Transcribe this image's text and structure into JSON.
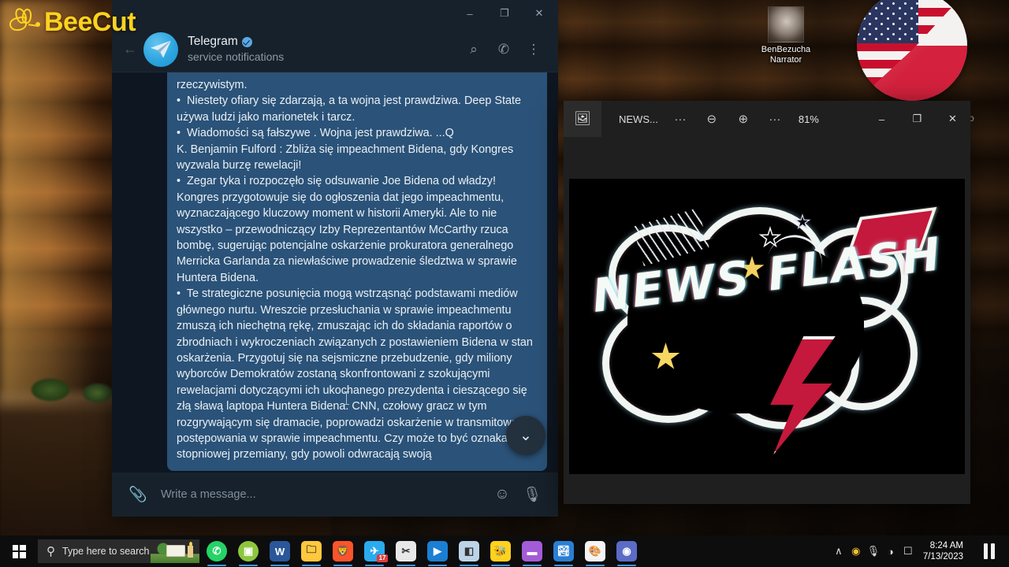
{
  "watermark": {
    "brand": "BeeCut",
    "icon": "bee-icon"
  },
  "desktop": {
    "shortcut": {
      "label_line1": "BenBezucha",
      "label_line2": "Narrator",
      "icon": "desktop-shortcut-icon"
    },
    "flag_graphic": {
      "name": "usa-poland-flag-circle"
    },
    "stray_glyph": "o"
  },
  "telegram": {
    "window_controls": {
      "minimize": "–",
      "maximize": "❐",
      "close": "✕"
    },
    "back_icon": "←",
    "chat": {
      "name": "Telegram",
      "verified": true,
      "subtitle": "service notifications",
      "avatar_icon": "telegram-plane-icon"
    },
    "header_actions": [
      {
        "name": "search-icon",
        "glyph": "⌕"
      },
      {
        "name": "call-icon",
        "glyph": "✆"
      },
      {
        "name": "more-menu-icon",
        "glyph": "⋮"
      }
    ],
    "message": "rzeczywistym.\n•  Niestety ofiary się zdarzają, a ta wojna jest prawdziwa. Deep State używa ludzi jako marionetek i tarcz.\n•  Wiadomości są fałszywe . Wojna jest prawdziwa. ...Q\nK. Benjamin Fulford : Zbliża się impeachment Bidena, gdy Kongres wyzwala burzę rewelacji!\n•  Zegar tyka i rozpoczęło się odsuwanie Joe Bidena od władzy! Kongres przygotowuje się do ogłoszenia dat jego impeachmentu, wyznaczającego kluczowy moment w historii Ameryki. Ale to nie wszystko – przewodniczący Izby Reprezentantów McCarthy rzuca bombę, sugerując potencjalne oskarżenie prokuratora generalnego Merricka Garlanda za niewłaściwe prowadzenie śledztwa w sprawie Huntera Bidena.\n•  Te strategiczne posunięcia mogą wstrząsnąć podstawami mediów głównego nurtu. Wreszcie przesłuchania w sprawie impeachmentu zmuszą ich niechętną rękę, zmuszając ich do składania raportów o zbrodniach i wykroczeniach związanych z postawieniem Bidena w stan oskarżenia. Przygotuj się na sejsmiczne przebudzenie, gdy miliony wyborców Demokratów zostaną skonfrontowani z szokującymi rewelacjami dotyczącymi ich ukochanego prezydenta i cieszącego się złą sławą laptopa Huntera Bidena. CNN, czołowy gracz w tym rozgrywającym się dramacie, poprowadzi oskarżenie w transmitowaniu postępowania w sprawie impeachmentu. Czy może to być oznaka ich stopniowej przemiany, gdy powoli odwracają swoją",
    "scroll_down_icon": "⌄",
    "composer": {
      "attach_icon": "📎",
      "placeholder": "Write a message...",
      "value": "",
      "emoji_icon": "☺",
      "mic_icon": "🎙"
    }
  },
  "photos": {
    "app_icon": "photos-app-icon",
    "filename": "NEWS...",
    "overflow_left": "···",
    "zoom_out_icon": "⊖",
    "zoom_in_icon": "⊕",
    "overflow_right": "···",
    "zoom_level": "81%",
    "window_controls": {
      "minimize": "–",
      "maximize": "❐",
      "close": "✕"
    },
    "image": {
      "title": "NEWS FLASH",
      "alt": "news-flash-logo"
    }
  },
  "taskbar": {
    "start": {
      "name": "start-button"
    },
    "search": {
      "placeholder": "Type here to search",
      "icon": "search-icon"
    },
    "apps": [
      {
        "name": "taskbar-whatsapp",
        "label": "✆",
        "color": "#25d366",
        "round": true,
        "open": true
      },
      {
        "name": "taskbar-greenapp",
        "label": "▣",
        "color": "#8cc63f",
        "round": true,
        "open": true
      },
      {
        "name": "taskbar-word",
        "label": "W",
        "color": "#2b579a",
        "open": true
      },
      {
        "name": "taskbar-file-explorer",
        "label": "🗀",
        "color": "#ffc83d",
        "open": true
      },
      {
        "name": "taskbar-brave",
        "label": "🦁",
        "color": "#fb542b",
        "open": true
      },
      {
        "name": "taskbar-telegram",
        "label": "✈",
        "color": "#2aabee",
        "badge": "17",
        "open": true
      },
      {
        "name": "taskbar-snipping-tool",
        "label": "✂",
        "color": "#e8e8e8",
        "open": true
      },
      {
        "name": "taskbar-movies-tv",
        "label": "▶",
        "color": "#1b7fd4",
        "open": true
      },
      {
        "name": "taskbar-3d-viewer",
        "label": "◧",
        "color": "#bcd4e6",
        "open": true
      },
      {
        "name": "taskbar-beecut",
        "label": "🐝",
        "color": "#ffd21e",
        "open": true
      },
      {
        "name": "taskbar-video-editor",
        "label": "▬",
        "color": "#a45bd8",
        "open": true
      },
      {
        "name": "taskbar-photos",
        "label": "🏞",
        "color": "#2a7fd4",
        "open": true
      },
      {
        "name": "taskbar-paint",
        "label": "🎨",
        "color": "#f4f4f4",
        "open": true
      },
      {
        "name": "taskbar-media-player",
        "label": "◉",
        "color": "#5b6cc6",
        "open": true
      }
    ],
    "tray": {
      "chevron": "∧",
      "icons": [
        {
          "name": "tray-beecut-icon",
          "glyph": "◉",
          "color": "#f2c12e"
        },
        {
          "name": "tray-microphone-icon",
          "glyph": "🎙",
          "color": "#e6e6e6"
        },
        {
          "name": "tray-network-icon",
          "glyph": "◠",
          "color": "#e6e6e6"
        },
        {
          "name": "tray-display-icon",
          "glyph": "❐",
          "color": "#e6e6e6"
        }
      ]
    },
    "clock": {
      "time": "8:24 AM",
      "date": "7/13/2023"
    },
    "recorder": {
      "name": "pause-recording-button"
    }
  }
}
